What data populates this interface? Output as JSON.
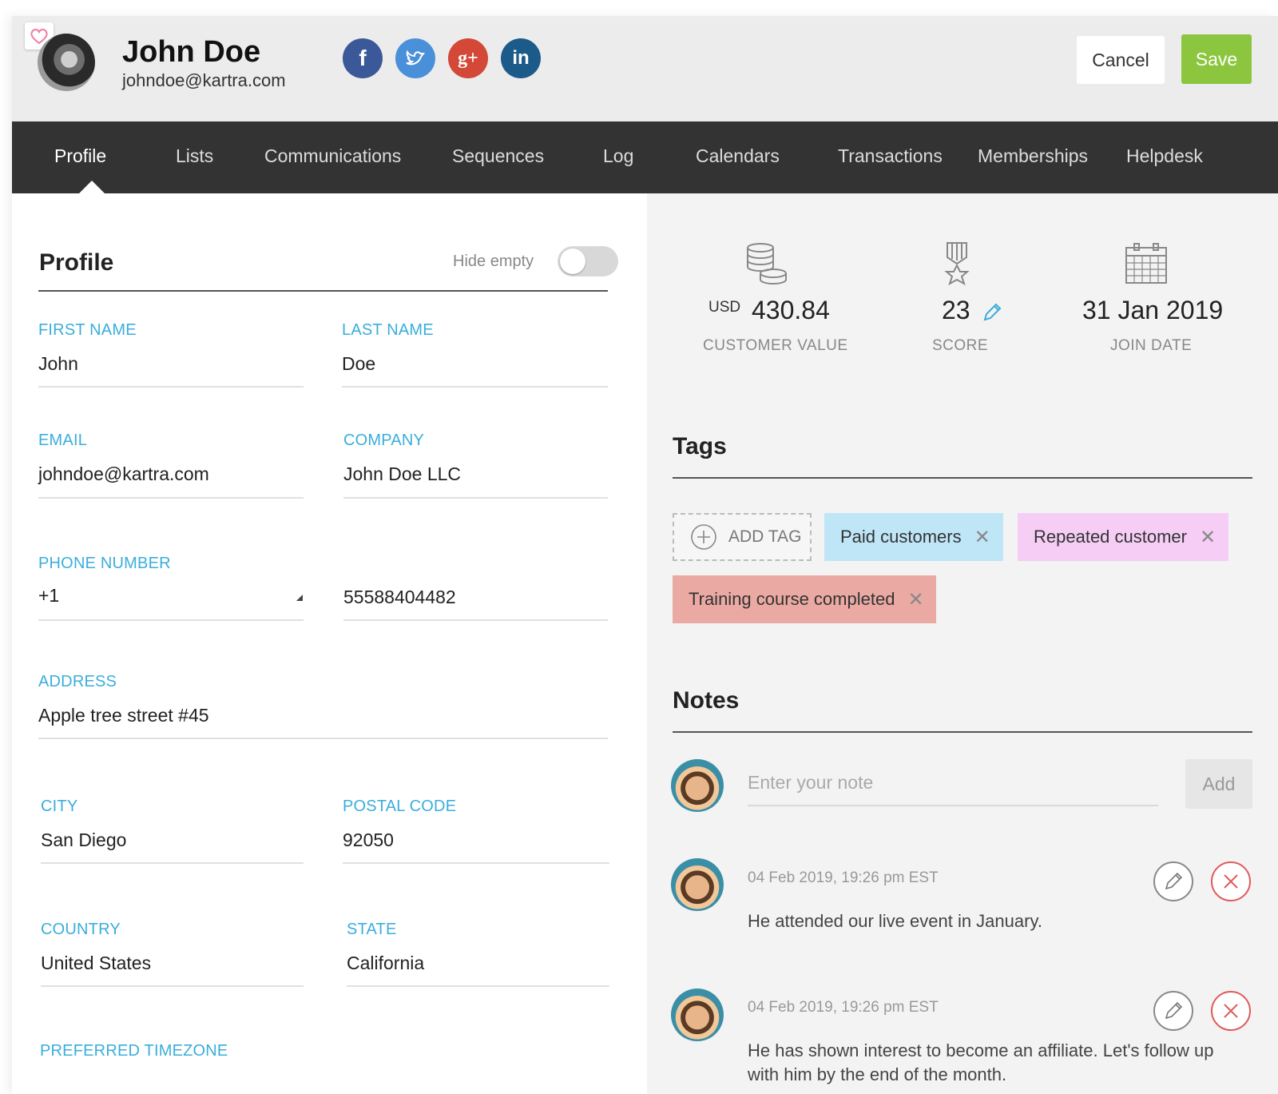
{
  "header": {
    "name": "John Doe",
    "email": "johndoe@kartra.com",
    "cancel_label": "Cancel",
    "save_label": "Save",
    "social": [
      {
        "icon": "facebook-icon",
        "glyph": "f",
        "color": "#3b5998"
      },
      {
        "icon": "twitter-icon",
        "glyph": "",
        "color": "#4a90d9"
      },
      {
        "icon": "google-plus-icon",
        "glyph": "g+",
        "color": "#d34836"
      },
      {
        "icon": "linkedin-icon",
        "glyph": "in",
        "color": "#1c5a8a"
      }
    ]
  },
  "nav": {
    "items": [
      {
        "label": "Profile",
        "active": true
      },
      {
        "label": "Lists"
      },
      {
        "label": "Communications"
      },
      {
        "label": "Sequences"
      },
      {
        "label": "Log"
      },
      {
        "label": "Calendars"
      },
      {
        "label": "Transactions"
      },
      {
        "label": "Memberships"
      },
      {
        "label": "Helpdesk"
      }
    ]
  },
  "profile": {
    "title": "Profile",
    "hide_empty_label": "Hide empty",
    "first_name_label": "FIRST NAME",
    "first_name": "John",
    "last_name_label": "LAST NAME",
    "last_name": "Doe",
    "email_label": "EMAIL",
    "email": "johndoe@kartra.com",
    "company_label": "COMPANY",
    "company": "John Doe LLC",
    "phone_label": "PHONE NUMBER",
    "phone_code": "+1",
    "phone_number": "55588404482",
    "address_label": "ADDRESS",
    "address": "Apple tree street #45",
    "city_label": "CITY",
    "city": "San Diego",
    "postal_label": "POSTAL CODE",
    "postal": "92050",
    "country_label": "COUNTRY",
    "country": "United States",
    "state_label": "STATE",
    "state": "California",
    "timezone_label": "PREFERRED TIMEZONE"
  },
  "stats": {
    "currency": "USD",
    "customer_value": "430.84",
    "customer_value_label": "CUSTOMER VALUE",
    "score": "23",
    "score_label": "SCORE",
    "join_date": "31 Jan 2019",
    "join_date_label": "JOIN DATE"
  },
  "tags": {
    "title": "Tags",
    "add_label": "ADD TAG",
    "items": [
      {
        "label": "Paid customers",
        "color": "#bfe6f7"
      },
      {
        "label": "Repeated customer",
        "color": "#f5cdf5"
      },
      {
        "label": "Training course completed",
        "color": "#eba9a3"
      }
    ]
  },
  "notes": {
    "title": "Notes",
    "placeholder": "Enter your note",
    "add_label": "Add",
    "items": [
      {
        "date": "04 Feb 2019, 19:26 pm EST",
        "text": "He attended our live event in January."
      },
      {
        "date": "04 Feb 2019, 19:26 pm EST",
        "text": "He has shown interest to become an affiliate. Let's follow up",
        "text2": "with him by the end of the month."
      }
    ]
  },
  "colors": {
    "accent_blue": "#3aaedb",
    "save_green": "#8cc63f",
    "nav_bg": "#333333",
    "delete_red": "#e05a5a"
  }
}
